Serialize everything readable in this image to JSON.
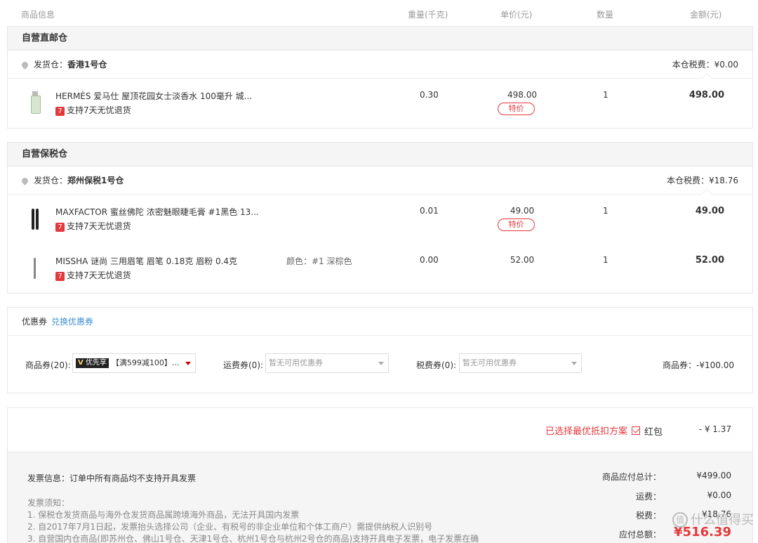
{
  "header": {
    "product": "商品信息",
    "weight": "重量(千克)",
    "price": "单价(元)",
    "qty": "数量",
    "amount": "金额(元)"
  },
  "warehouses": [
    {
      "title": "自营直邮仓",
      "ship_label": "发货仓：",
      "ship_name": "香港1号仓",
      "tax": "本仓税费：¥0.00",
      "items": [
        {
          "icon": "perfume-bottle-icon",
          "name": "HERMÈS 爱马仕 屋顶花园女士淡香水 100毫升 城...",
          "return_badge": "7",
          "return_text": "支持7天无忧退货",
          "attr": "",
          "weight": "0.30",
          "price": "498.00",
          "special": "特价",
          "qty": "1",
          "amount": "498.00"
        }
      ]
    },
    {
      "title": "自营保税仓",
      "ship_label": "发货仓：",
      "ship_name": "郑州保税1号仓",
      "tax": "本仓税费：¥18.76",
      "items": [
        {
          "icon": "mascara-icon",
          "name": "MAXFACTOR 蜜丝佛陀 浓密魅眼睫毛膏 #1黑色 13...",
          "return_badge": "7",
          "return_text": "支持7天无忧退货",
          "attr": "",
          "weight": "0.01",
          "price": "49.00",
          "special": "特价",
          "qty": "1",
          "amount": "49.00"
        },
        {
          "icon": "eyebrow-pencil-icon",
          "name": "MISSHA 谜尚 三用眉笔 眉笔 0.18克 眉粉 0.4克",
          "return_badge": "7",
          "return_text": "支持7天无忧退货",
          "attr": "颜色：#1 深棕色",
          "weight": "0.00",
          "price": "52.00",
          "special": "",
          "qty": "1",
          "amount": "52.00"
        }
      ]
    }
  ],
  "coupon": {
    "title": "优惠券",
    "link": "兑换优惠券",
    "product_label": "商品券(20):",
    "product_tag_v": "V",
    "product_tag": "优先享",
    "product_value": "【满599减100】...",
    "shipping_label": "运费券(0):",
    "shipping_placeholder": "暂无可用优惠券",
    "tax_label": "税费券(0):",
    "tax_placeholder": "暂无可用优惠券",
    "discount": "商品券：-¥100.00"
  },
  "summary": {
    "best_plan": "已选择最优抵扣方案",
    "red_packet_label": "红包",
    "red_packet_value": "- ¥ 1.37",
    "invoice_label": "发票信息：",
    "invoice_text": "订单中所有商品均不支持开具发票",
    "notes_title": "发票须知：",
    "notes": [
      "1. 保税仓发货商品与海外仓发货商品属跨境海外商品，无法开具国内发票",
      "2. 自2017年7月1日起，发票抬头选择公司（企业、有税号的非企业单位和个体工商户）需提供纳税人识别号",
      "3. 自营国内仓商品(即苏州仓、佛山1号仓、天津1号仓、杭州1号仓与杭州2号仓的商品)支持开具电子发票，电子发票在确"
    ],
    "totals": [
      {
        "label": "商品应付总计：",
        "value": "¥499.00"
      },
      {
        "label": "运费：",
        "value": "¥0.00"
      },
      {
        "label": "税费：",
        "value": "¥18.76"
      },
      {
        "label": "应付总额：",
        "value": "¥516.39"
      }
    ],
    "watermark": "什么值得买",
    "watermark_glyph": "值"
  }
}
